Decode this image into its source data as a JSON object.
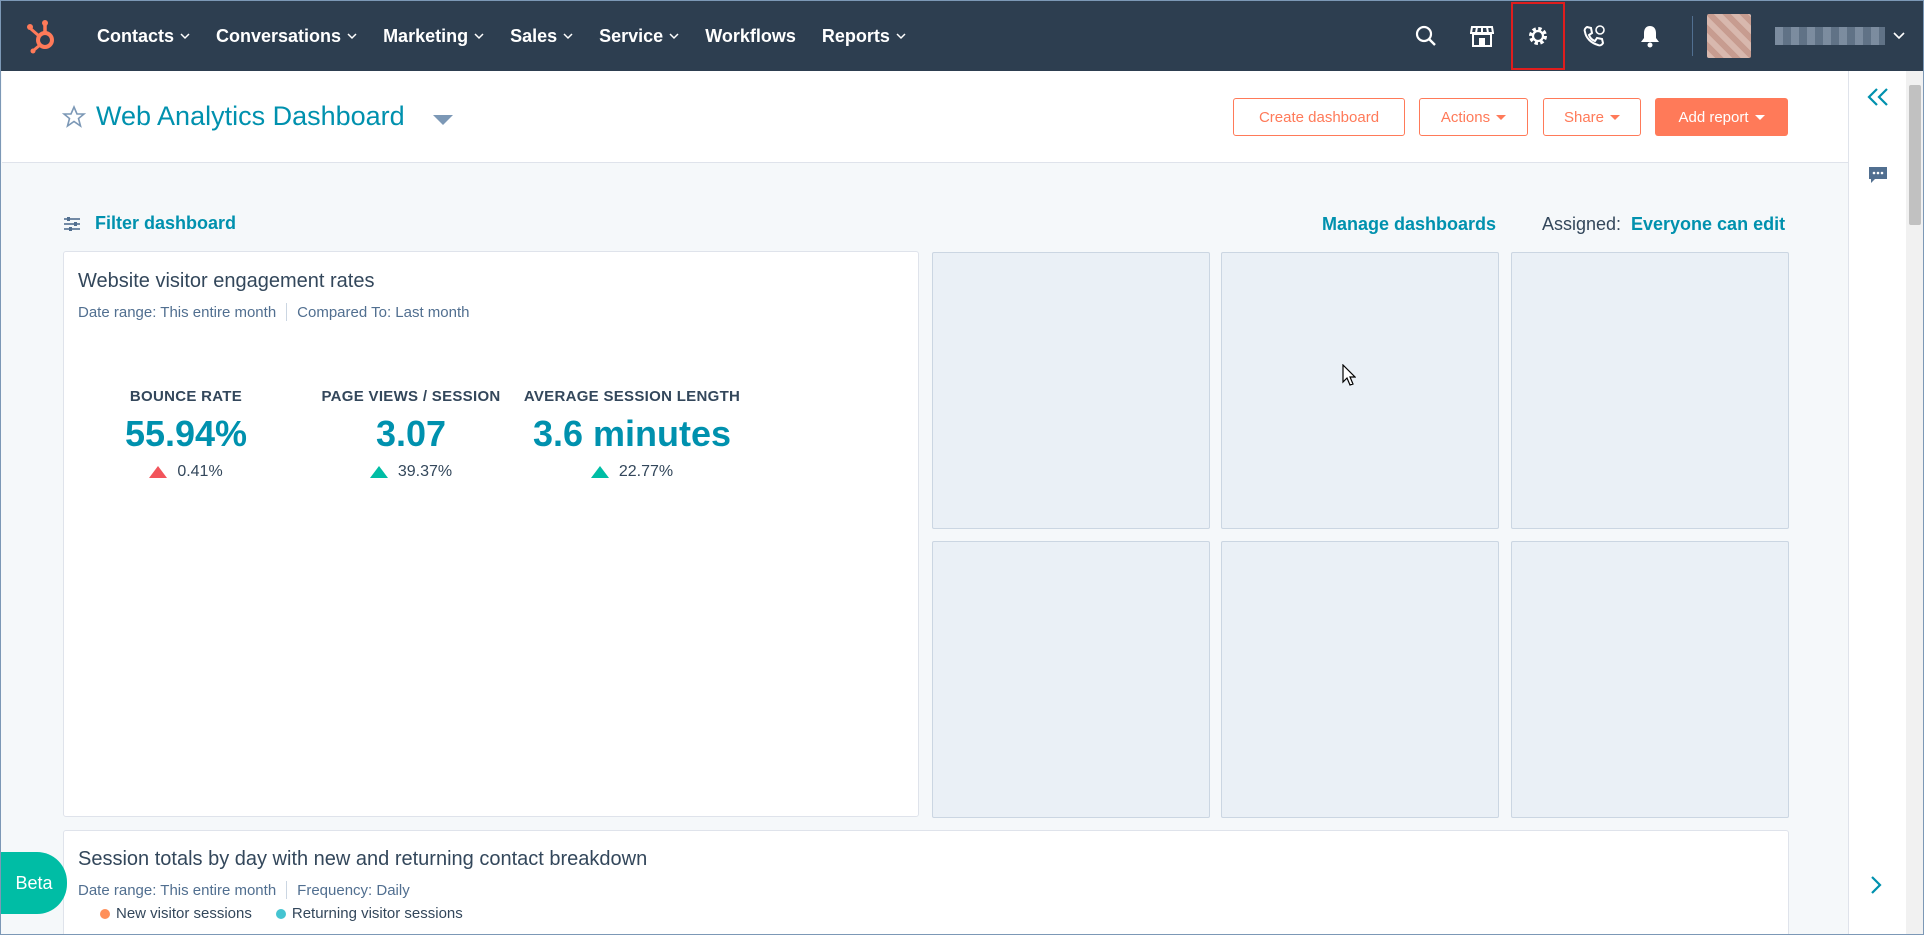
{
  "nav": {
    "items": [
      {
        "label": "Contacts",
        "dropdown": true
      },
      {
        "label": "Conversations",
        "dropdown": true
      },
      {
        "label": "Marketing",
        "dropdown": true
      },
      {
        "label": "Sales",
        "dropdown": true
      },
      {
        "label": "Service",
        "dropdown": true
      },
      {
        "label": "Workflows",
        "dropdown": false
      },
      {
        "label": "Reports",
        "dropdown": true
      }
    ],
    "icons": [
      "search-icon",
      "marketplace-icon",
      "settings-icon",
      "calling-icon",
      "notifications-icon"
    ],
    "highlighted_icon": "settings-icon"
  },
  "header": {
    "title": "Web Analytics Dashboard",
    "create_label": "Create dashboard",
    "actions_label": "Actions",
    "share_label": "Share",
    "add_report_label": "Add report"
  },
  "filter_row": {
    "filter_label": "Filter dashboard",
    "manage_label": "Manage dashboards",
    "assigned_label": "Assigned:",
    "assigned_value": "Everyone can edit"
  },
  "report1": {
    "title": "Website visitor engagement rates",
    "date_range": "Date range: This entire month",
    "compared_to": "Compared To: Last month",
    "kpis": [
      {
        "label": "BOUNCE RATE",
        "value": "55.94%",
        "change": "0.41%",
        "direction": "up",
        "color": "#f2545b"
      },
      {
        "label": "PAGE VIEWS / SESSION",
        "value": "3.07",
        "change": "39.37%",
        "direction": "up",
        "color": "#00bda5"
      },
      {
        "label": "AVERAGE SESSION LENGTH",
        "value": "3.6 minutes",
        "change": "22.77%",
        "direction": "up",
        "color": "#00bda5"
      }
    ]
  },
  "report2": {
    "title": "Session totals by day with new and returning contact breakdown",
    "date_range": "Date range: This entire month",
    "frequency": "Frequency: Daily",
    "legend": [
      {
        "label": "New visitor sessions",
        "color": "#ff8f59"
      },
      {
        "label": "Returning visitor sessions",
        "color": "#45c4d1"
      }
    ]
  },
  "beta_label": "Beta",
  "colors": {
    "nav_bg": "#2d3e50",
    "accent": "#ff7a59",
    "link": "#0091ae"
  }
}
